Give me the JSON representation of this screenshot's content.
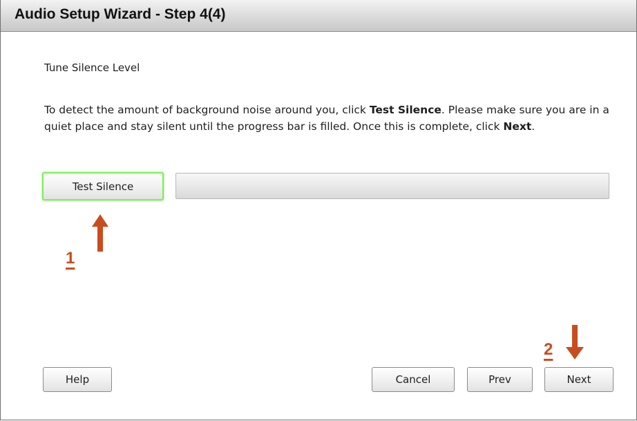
{
  "window": {
    "title": "Audio Setup Wizard - Step 4(4)"
  },
  "section": {
    "title": "Tune Silence Level"
  },
  "instructions": {
    "line1_pre": "To detect the amount of background noise around you, click ",
    "line1_bold": "Test Silence",
    "line1_post": ". Please make sure you are in a quiet place and stay silent until the progress bar is filled. Once this is complete, click ",
    "line2_bold": "Next",
    "line2_post": "."
  },
  "test_silence": {
    "label": "Test Silence"
  },
  "progress": {
    "value_percent": 0
  },
  "annotations": {
    "step1": "1",
    "step2": "2",
    "color": "#c84d1e"
  },
  "footer": {
    "help_label": "Help",
    "cancel_label": "Cancel",
    "prev_label": "Prev",
    "next_label": "Next"
  },
  "colors": {
    "focus_outline": "#7cf05c",
    "text": "#1e1e1e"
  }
}
